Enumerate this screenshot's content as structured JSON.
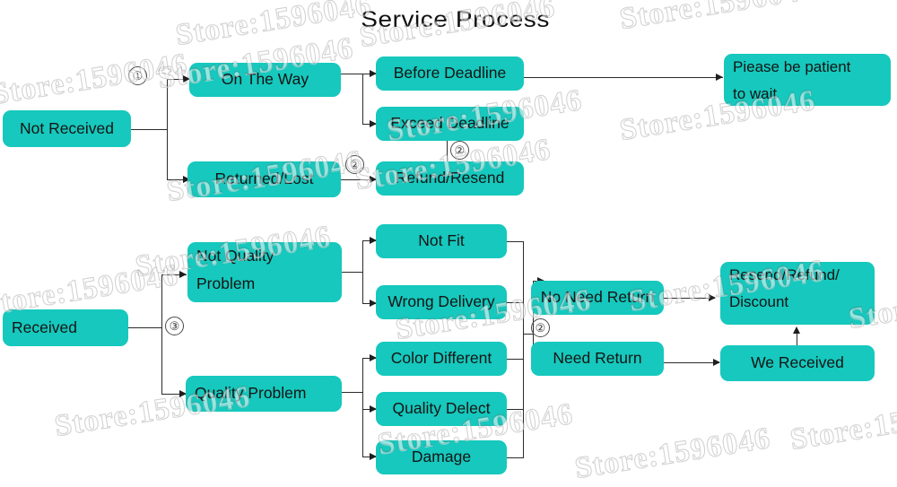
{
  "title": "Service Process",
  "watermark_text": "Store:1596046",
  "colors": {
    "node_fill": "#16c8bd",
    "line": "#2b2b2b",
    "text": "#141414",
    "background": "#ffffff"
  },
  "markers": {
    "one": "①",
    "two_a": "②",
    "two_b": "②",
    "two_c": "②",
    "three": "③"
  },
  "flow_top": {
    "root": "Not Received",
    "branches": [
      {
        "label": "On The Way"
      },
      {
        "label": "Returned/Lost"
      }
    ],
    "deadline": [
      {
        "label": "Before Deadline"
      },
      {
        "label": "Exceed Deadline"
      }
    ],
    "refund": "Refund/Resend",
    "outcome_line1": "Piease be patient",
    "outcome_line2": "to wait"
  },
  "flow_bottom": {
    "root": "Received",
    "categories": [
      {
        "line1": "Not Quality",
        "line2": "Problem"
      },
      {
        "line1": "Quality Problem",
        "line2": ""
      }
    ],
    "not_quality_reasons": [
      {
        "label": "Not Fit"
      },
      {
        "label": "Wrong Delivery"
      }
    ],
    "quality_reasons": [
      {
        "label": "Color Different"
      },
      {
        "label": "Quality Delect"
      },
      {
        "label": "Damage"
      }
    ],
    "return_options": [
      {
        "label": "No Need Return"
      },
      {
        "label": "Need Return"
      }
    ],
    "resolution_line1": "Resend/Refund/",
    "resolution_line2": "Discount",
    "we_received": "We Received"
  }
}
